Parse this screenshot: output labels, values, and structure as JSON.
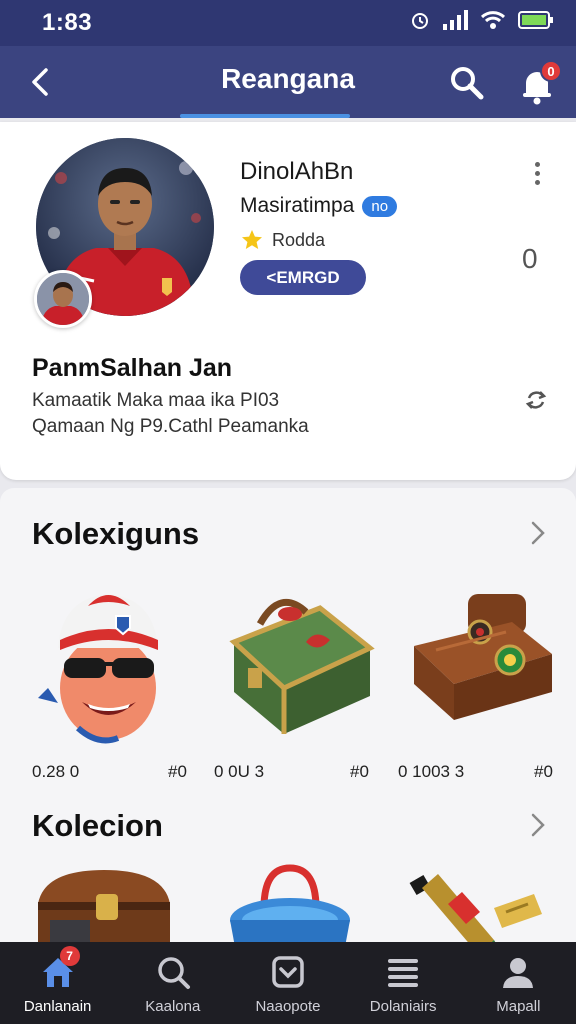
{
  "status_bar": {
    "time": "1:83",
    "battery_color": "#7ed957"
  },
  "header": {
    "title": "Reangana",
    "notification_count": "0",
    "accent_color": "#4a90e2"
  },
  "profile": {
    "name": "DinolAhBn",
    "subtitle": "Masiratimpa",
    "level_badge": "no",
    "rank_label": "Rodda",
    "follow_label": "<EMRGD",
    "count": "0",
    "bio_title": "PanmSalhan Jan",
    "bio_line1": "Kamaatik Maka maa ika PI03",
    "bio_line2": "Qamaan Ng P9.Cathl Peamanka"
  },
  "collections": [
    {
      "title": "Kolexiguns",
      "items": [
        {
          "icon": "mascot-head-icon",
          "label_left": "0.28 0",
          "label_right": "#0"
        },
        {
          "icon": "green-chest-icon",
          "label_left": "0 0U 3",
          "label_right": "#0"
        },
        {
          "icon": "brown-bag-icon",
          "label_left": "0 1003 3",
          "label_right": "#0"
        }
      ]
    },
    {
      "title": "Kolecion",
      "items": [
        {
          "icon": "treasure-chest-icon"
        },
        {
          "icon": "bucket-icon"
        },
        {
          "icon": "tools-icon"
        }
      ]
    }
  ],
  "bottom_nav": [
    {
      "label": "Danlanain",
      "icon": "home-icon",
      "badge": "7",
      "active": true
    },
    {
      "label": "Kaalona",
      "icon": "search-icon"
    },
    {
      "label": "Naaopote",
      "icon": "inbox-icon"
    },
    {
      "label": "Dolaniairs",
      "icon": "menu-icon"
    },
    {
      "label": "Mapall",
      "icon": "profile-icon"
    }
  ]
}
